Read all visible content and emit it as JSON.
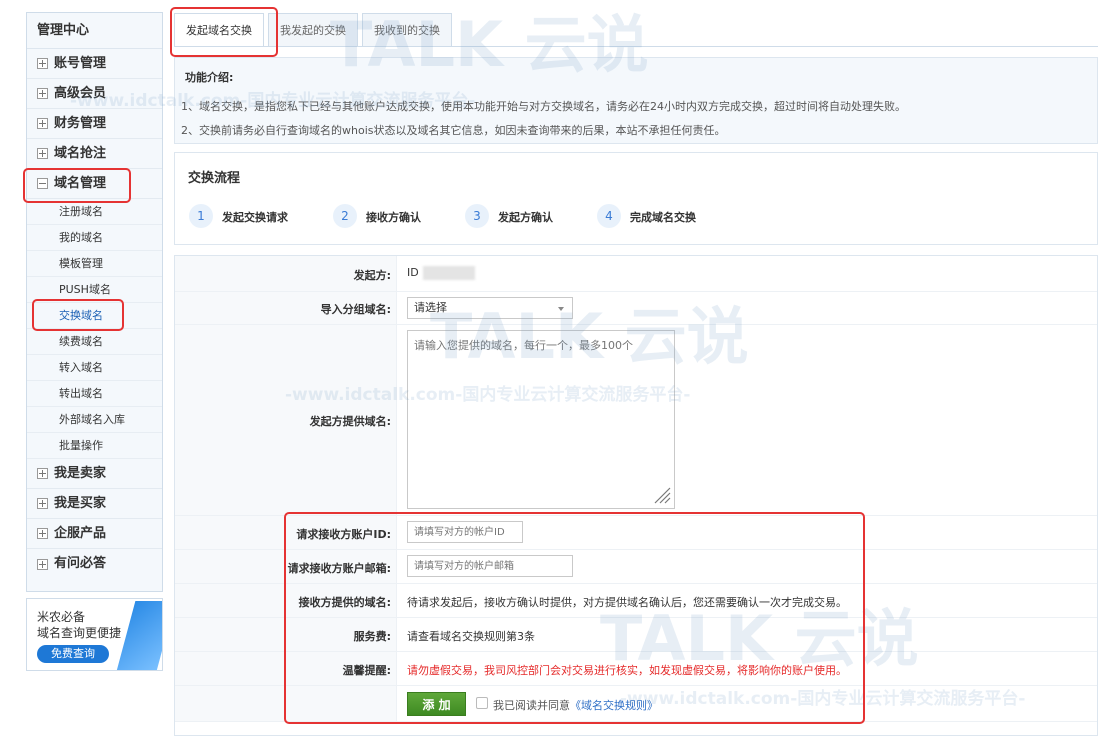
{
  "sidebar": {
    "title": "管理中心",
    "groups_top": [
      {
        "label": "账号管理"
      },
      {
        "label": "高级会员"
      },
      {
        "label": "财务管理"
      },
      {
        "label": "域名抢注"
      }
    ],
    "expanded_group": {
      "label": "域名管理"
    },
    "sub_items": [
      {
        "label": "注册域名"
      },
      {
        "label": "我的域名"
      },
      {
        "label": "模板管理"
      },
      {
        "label": "PUSH域名"
      },
      {
        "label": "交换域名"
      },
      {
        "label": "续费域名"
      },
      {
        "label": "转入域名"
      },
      {
        "label": "转出域名"
      },
      {
        "label": "外部域名入库"
      },
      {
        "label": "批量操作"
      }
    ],
    "groups_bottom": [
      {
        "label": "我是卖家"
      },
      {
        "label": "我是买家"
      },
      {
        "label": "企服产品"
      },
      {
        "label": "有问必答"
      }
    ]
  },
  "promo": {
    "line1": "米农必备",
    "line2": "域名查询更便捷",
    "button": "免费查询"
  },
  "tabs": [
    {
      "label": "发起域名交换"
    },
    {
      "label": "我发起的交换"
    },
    {
      "label": "我收到的交换"
    }
  ],
  "intro": {
    "title": "功能介绍:",
    "line1": "1、域名交换，是指您私下已经与其他账户达成交换，使用本功能开始与对方交换域名，请务必在24小时内双方完成交换，超过时间将自动处理失败。",
    "line2": "2、交换前请务必自行查询域名的whois状态以及域名其它信息，如因未查询带来的后果，本站不承担任何责任。"
  },
  "flow": {
    "title": "交换流程",
    "steps": [
      {
        "num": "1",
        "label": "发起交换请求"
      },
      {
        "num": "2",
        "label": "接收方确认"
      },
      {
        "num": "3",
        "label": "发起方确认"
      },
      {
        "num": "4",
        "label": "完成域名交换"
      }
    ]
  },
  "form": {
    "initiator_label": "发起方:",
    "initiator_value": "ID",
    "group_label": "导入分组域名:",
    "group_select": "请选择",
    "domains_label": "发起方提供域名:",
    "domains_placeholder": "请输入您提供的域名，每行一个，最多100个",
    "account_id_label": "请求接收方账户ID:",
    "account_id_placeholder": "请填写对方的帐户ID",
    "email_label": "请求接收方账户邮箱:",
    "email_placeholder": "请填写对方的帐户邮箱",
    "receiver_domains_label": "接收方提供的域名:",
    "receiver_domains_text": "待请求发起后，接收方确认时提供，对方提供域名确认后，您还需要确认一次才完成交易。",
    "fee_label": "服务费:",
    "fee_text": "请查看域名交换规则第3条",
    "tip_label": "温馨提醒:",
    "tip_text": "请勿虚假交易，我司风控部门会对交易进行核实，如发现虚假交易，将影响你的账户使用。",
    "add_button": "添 加",
    "agree_text": "我已阅读并同意",
    "agree_link": "《域名交换规则》"
  },
  "watermark": {
    "brand": "TALK 云说",
    "url": "-www.idctalk.com-国内专业云计算交流服务平台-"
  },
  "colors": {
    "accent": "#1e78d6",
    "highlight": "#e53333",
    "button_green": "#4f9a2e",
    "warning_text": "#e52a2a"
  }
}
